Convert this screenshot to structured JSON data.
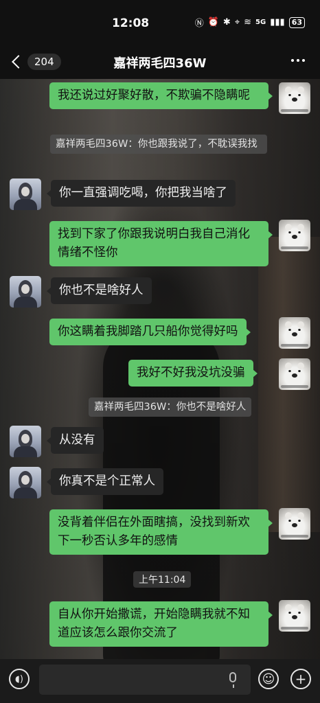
{
  "status_bar": {
    "time": "12:08",
    "network": "5G",
    "battery": "63"
  },
  "header": {
    "unread_count": "204",
    "title": "嘉祥两毛四36W"
  },
  "messages": [
    {
      "side": "me",
      "text": "我还说过好聚好散，不欺骗不隐瞒呢"
    },
    {
      "type": "quote",
      "text": "嘉祥两毛四36W：你也跟我说了，不耽误我找"
    },
    {
      "side": "them",
      "text": "你一直强调吃喝，你把我当啥了"
    },
    {
      "side": "me",
      "text": "找到下家了你跟我说明白我自己消化情绪不怪你"
    },
    {
      "side": "them",
      "text": "你也不是啥好人"
    },
    {
      "side": "me",
      "text": "你这瞒着我脚踏几只船你觉得好吗"
    },
    {
      "side": "me",
      "text": "我好不好我没坑没骗"
    },
    {
      "type": "quote",
      "text": "嘉祥两毛四36W：你也不是啥好人"
    },
    {
      "side": "them",
      "text": "从没有"
    },
    {
      "side": "them",
      "text": "你真不是个正常人"
    },
    {
      "side": "me",
      "text": "没背着伴侣在外面瞎搞，没找到新欢下一秒否认多年的感情"
    },
    {
      "type": "time",
      "text": "上午11:04"
    },
    {
      "side": "me",
      "text": "自从你开始撒谎，开始隐瞒我就不知道应该怎么跟你交流了"
    }
  ],
  "input_bar": {
    "placeholder": ""
  },
  "colors": {
    "me_bubble": "#60c66b",
    "them_bubble": "#262626"
  }
}
